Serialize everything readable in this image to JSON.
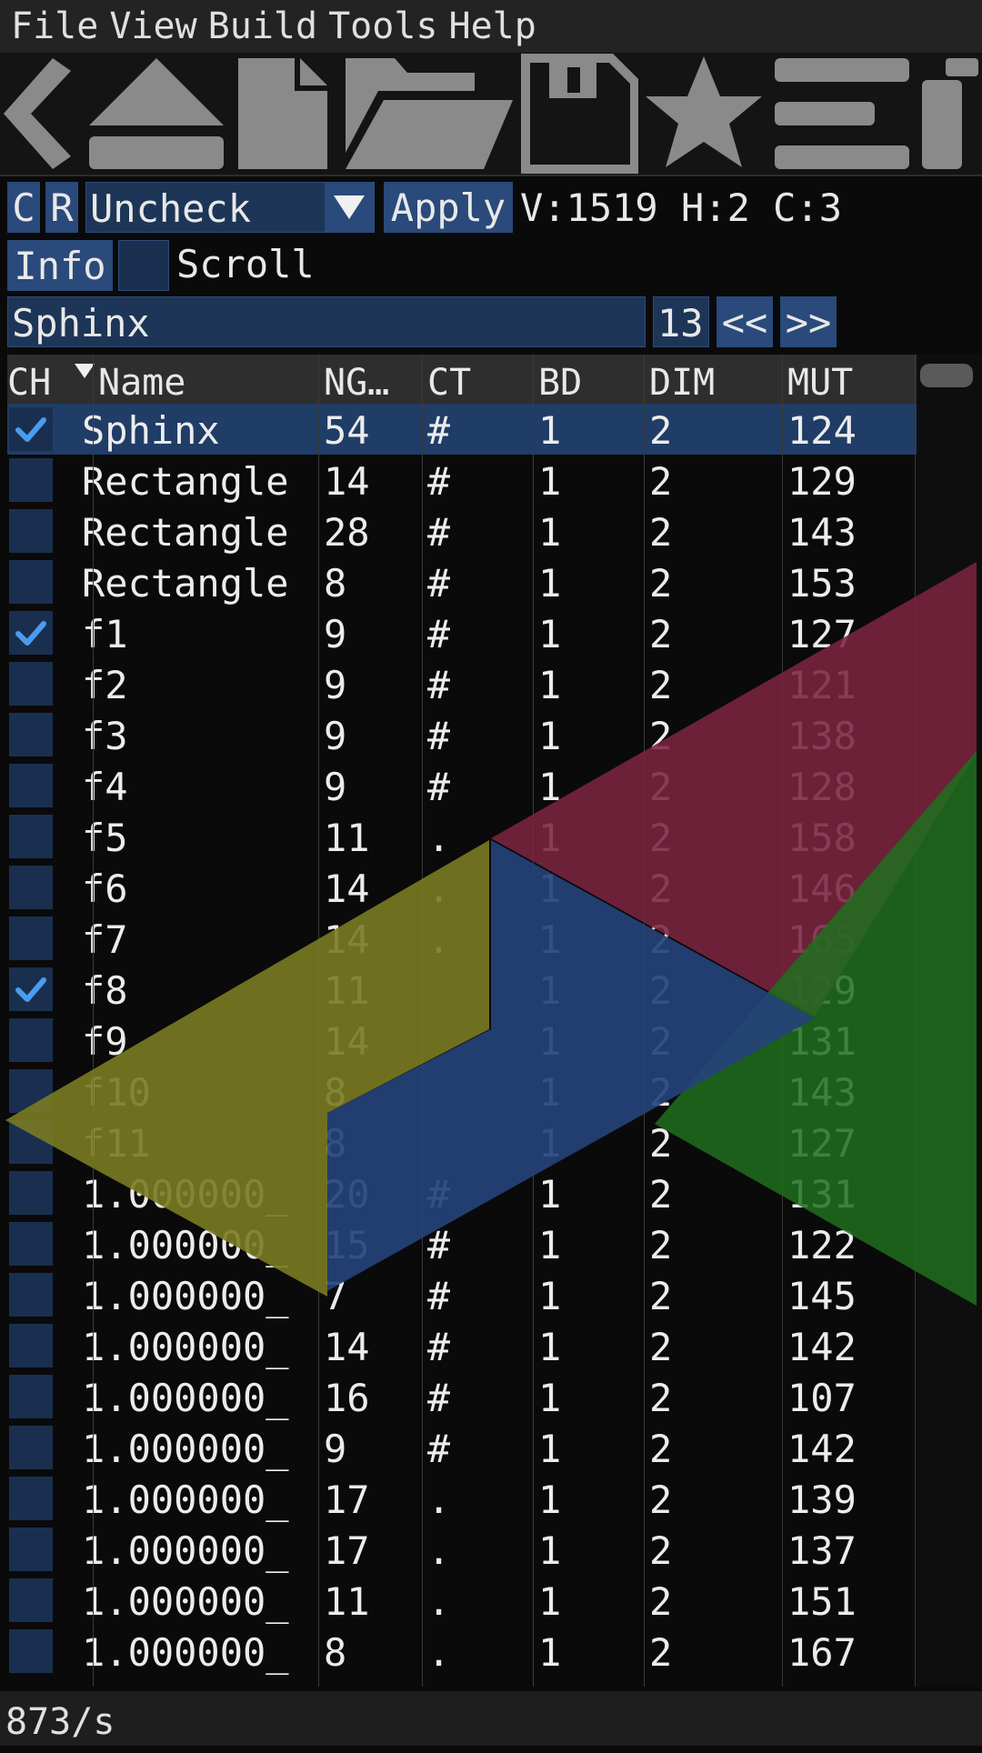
{
  "menu": [
    "File",
    "View",
    "Build",
    "Tools",
    "Help"
  ],
  "toolbar_icons": [
    "back-icon",
    "eject-icon",
    "new-file-icon",
    "open-folder-icon",
    "save-icon",
    "star-icon",
    "list-icon",
    "partial-icon"
  ],
  "controls": {
    "c_label": "C",
    "r_label": "R",
    "combo_value": "Uncheck",
    "apply_label": "Apply",
    "stats": "V:1519 H:2 C:3",
    "info_label": "Info",
    "scroll_label": "Scroll",
    "search_value": "Sphinx",
    "count_value": "13",
    "prev_label": "<<",
    "next_label": ">>"
  },
  "table": {
    "headers": [
      "CH",
      "Name",
      "NG…",
      "CT",
      "BD",
      "DIM",
      "MUT"
    ],
    "rows": [
      {
        "checked": true,
        "selected": true,
        "name": "Sphinx",
        "ng": "54",
        "ct": "#",
        "bd": "1",
        "dim": "2",
        "mut": "124"
      },
      {
        "checked": false,
        "selected": false,
        "name": "Rectangle",
        "ng": "14",
        "ct": "#",
        "bd": "1",
        "dim": "2",
        "mut": "129"
      },
      {
        "checked": false,
        "selected": false,
        "name": "Rectangle",
        "ng": "28",
        "ct": "#",
        "bd": "1",
        "dim": "2",
        "mut": "143"
      },
      {
        "checked": false,
        "selected": false,
        "name": "Rectangle",
        "ng": "8",
        "ct": "#",
        "bd": "1",
        "dim": "2",
        "mut": "153"
      },
      {
        "checked": true,
        "selected": false,
        "name": "f1",
        "ng": "9",
        "ct": "#",
        "bd": "1",
        "dim": "2",
        "mut": "127"
      },
      {
        "checked": false,
        "selected": false,
        "name": "f2",
        "ng": "9",
        "ct": "#",
        "bd": "1",
        "dim": "2",
        "mut": "121"
      },
      {
        "checked": false,
        "selected": false,
        "name": "f3",
        "ng": "9",
        "ct": "#",
        "bd": "1",
        "dim": "2",
        "mut": "138"
      },
      {
        "checked": false,
        "selected": false,
        "name": "f4",
        "ng": "9",
        "ct": "#",
        "bd": "1",
        "dim": "2",
        "mut": "128"
      },
      {
        "checked": false,
        "selected": false,
        "name": "f5",
        "ng": "11",
        "ct": ".",
        "bd": "1",
        "dim": "2",
        "mut": "158"
      },
      {
        "checked": false,
        "selected": false,
        "name": "f6",
        "ng": "14",
        "ct": ".",
        "bd": "1",
        "dim": "2",
        "mut": "146"
      },
      {
        "checked": false,
        "selected": false,
        "name": "f7",
        "ng": "14",
        "ct": ".",
        "bd": "1",
        "dim": "2",
        "mut": "165"
      },
      {
        "checked": true,
        "selected": false,
        "name": "f8",
        "ng": "11",
        "ct": "",
        "bd": "1",
        "dim": "2",
        "mut": "129"
      },
      {
        "checked": false,
        "selected": false,
        "name": "f9",
        "ng": "14",
        "ct": "",
        "bd": "1",
        "dim": "2",
        "mut": "131"
      },
      {
        "checked": false,
        "selected": false,
        "name": "f10",
        "ng": "8",
        "ct": "",
        "bd": "1",
        "dim": "2",
        "mut": "143"
      },
      {
        "checked": false,
        "selected": false,
        "name": "f11",
        "ng": "8",
        "ct": "",
        "bd": "1",
        "dim": "2",
        "mut": "127"
      },
      {
        "checked": false,
        "selected": false,
        "name": "1.000000_",
        "ng": "20",
        "ct": "#",
        "bd": "1",
        "dim": "2",
        "mut": "131"
      },
      {
        "checked": false,
        "selected": false,
        "name": "1.000000_",
        "ng": "15",
        "ct": "#",
        "bd": "1",
        "dim": "2",
        "mut": "122"
      },
      {
        "checked": false,
        "selected": false,
        "name": "1.000000_",
        "ng": "7",
        "ct": "#",
        "bd": "1",
        "dim": "2",
        "mut": "145"
      },
      {
        "checked": false,
        "selected": false,
        "name": "1.000000_",
        "ng": "14",
        "ct": "#",
        "bd": "1",
        "dim": "2",
        "mut": "142"
      },
      {
        "checked": false,
        "selected": false,
        "name": "1.000000_",
        "ng": "16",
        "ct": "#",
        "bd": "1",
        "dim": "2",
        "mut": "107"
      },
      {
        "checked": false,
        "selected": false,
        "name": "1.000000_",
        "ng": "9",
        "ct": "#",
        "bd": "1",
        "dim": "2",
        "mut": "142"
      },
      {
        "checked": false,
        "selected": false,
        "name": "1.000000_",
        "ng": "17",
        "ct": ".",
        "bd": "1",
        "dim": "2",
        "mut": "139"
      },
      {
        "checked": false,
        "selected": false,
        "name": "1.000000_",
        "ng": "17",
        "ct": ".",
        "bd": "1",
        "dim": "2",
        "mut": "137"
      },
      {
        "checked": false,
        "selected": false,
        "name": "1.000000_",
        "ng": "11",
        "ct": ".",
        "bd": "1",
        "dim": "2",
        "mut": "151"
      },
      {
        "checked": false,
        "selected": false,
        "name": "1.000000_",
        "ng": "8",
        "ct": ".",
        "bd": "1",
        "dim": "2",
        "mut": "167"
      }
    ]
  },
  "overlay_colors": {
    "yellow": "#7a7a22",
    "blue": "#25427a",
    "magenta": "#7a2440",
    "green": "#1f6f1f"
  },
  "status": {
    "fps": "873/s"
  },
  "colors": {
    "accent": "#294a7a",
    "check": "#4a9cf0",
    "selected_row": "#1f3d66"
  }
}
